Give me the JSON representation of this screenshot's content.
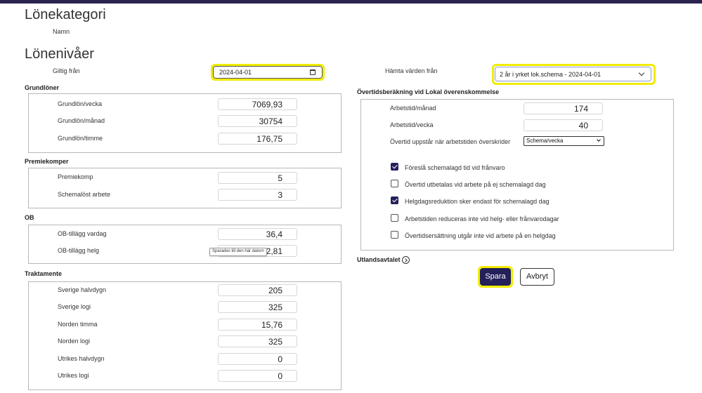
{
  "page": {
    "title": "Lönekategori",
    "name_label": "Namn",
    "levels_title": "Lönenivåer"
  },
  "validity": {
    "label": "Giltig från",
    "date_value": "2024-04-01"
  },
  "fetch": {
    "label": "Hämta värden från",
    "selected": "2 år i yrket lok.schema - 2024-04-01"
  },
  "sections": {
    "grundloner": {
      "title": "Grundlöner",
      "rows": [
        {
          "label": "Grundlön/vecka",
          "value": "7069,93"
        },
        {
          "label": "Grundlön/månad",
          "value": "30754"
        },
        {
          "label": "Grundlön/timme",
          "value": "176,75"
        }
      ]
    },
    "premiekomper": {
      "title": "Premiekomper",
      "rows": [
        {
          "label": "Premiekomp",
          "value": "5"
        },
        {
          "label": "Schemalöst arbete",
          "value": "3"
        }
      ]
    },
    "ob": {
      "title": "OB",
      "rows": [
        {
          "label": "OB-tillägg vardag",
          "value": "36,4"
        },
        {
          "label": "OB-tillägg helg",
          "value": "2,81"
        }
      ]
    },
    "traktamente": {
      "title": "Traktamente",
      "rows": [
        {
          "label": "Sverige halvdygn",
          "value": "205"
        },
        {
          "label": "Sverige logi",
          "value": "325"
        },
        {
          "label": "Norden timma",
          "value": "15,76"
        },
        {
          "label": "Norden logi",
          "value": "325"
        },
        {
          "label": "Utrikes halvdygn",
          "value": "0"
        },
        {
          "label": "Utrikes logi",
          "value": "0"
        }
      ]
    }
  },
  "tooltip": "Sparades till den här datorn",
  "overtime": {
    "title": "Övertidsberäkning vid Lokal överenskommelse",
    "rows": [
      {
        "label": "Arbetstid/månad",
        "value": "174"
      },
      {
        "label": "Arbetstid/vecka",
        "value": "40"
      }
    ],
    "threshold_label": "Övertid uppstår när arbetstiden överskrider",
    "threshold_selected": "Schema/vecka",
    "checkboxes": [
      {
        "label": "Föreslå schemalagd tid vid frånvaro",
        "checked": true
      },
      {
        "label": "Övertid utbetalas vid arbete på ej schemalagd dag",
        "checked": false
      },
      {
        "label": "Helgdagsreduktion sker endast för schemalagd dag",
        "checked": true
      },
      {
        "label": "Arbetstiden reduceras inte vid helg- eller frånvarodagar",
        "checked": false
      },
      {
        "label": "Övertidsersättning utgår inte vid arbete på en helgdag",
        "checked": false
      }
    ]
  },
  "abroad": {
    "label": "Utlandsavtalet"
  },
  "actions": {
    "save": "Spara",
    "cancel": "Avbryt"
  },
  "colors": {
    "primary": "#23205a",
    "focus_ring": "#f2ec00",
    "topbar": "#2b2450"
  }
}
